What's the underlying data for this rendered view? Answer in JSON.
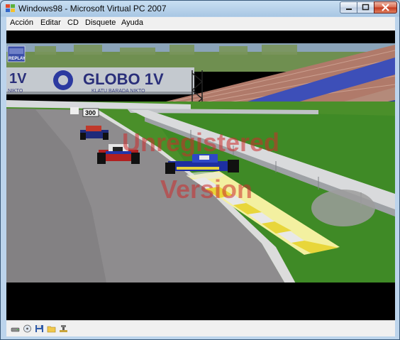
{
  "window": {
    "title": "Windows98 - Microsoft Virtual PC 2007"
  },
  "menu": {
    "items": [
      "Acción",
      "Editar",
      "CD",
      "Disquete",
      "Ayuda"
    ]
  },
  "game": {
    "hud": {
      "replay_label": "REPLAY"
    },
    "signs": {
      "billboard_left": "1V",
      "billboard_brand": "GLOBO 1V",
      "billboard_sub_left": "NIKTO",
      "billboard_sub_right": "KLATU BARADA NIKTO",
      "distance_marker": "300"
    },
    "watermark": {
      "line1": "Unregistered",
      "line2": "Version"
    }
  },
  "statusbar": {
    "icons": [
      "hard-disk-icon",
      "cd-drive-icon",
      "floppy-icon",
      "shared-folder-icon",
      "network-icon"
    ]
  },
  "colors": {
    "title_gradient_top": "#c9dff2",
    "close_button": "#c4381d",
    "grass": "#4a8f2a",
    "track": "#8f8d8f",
    "watermark": "#cc2b2b"
  }
}
